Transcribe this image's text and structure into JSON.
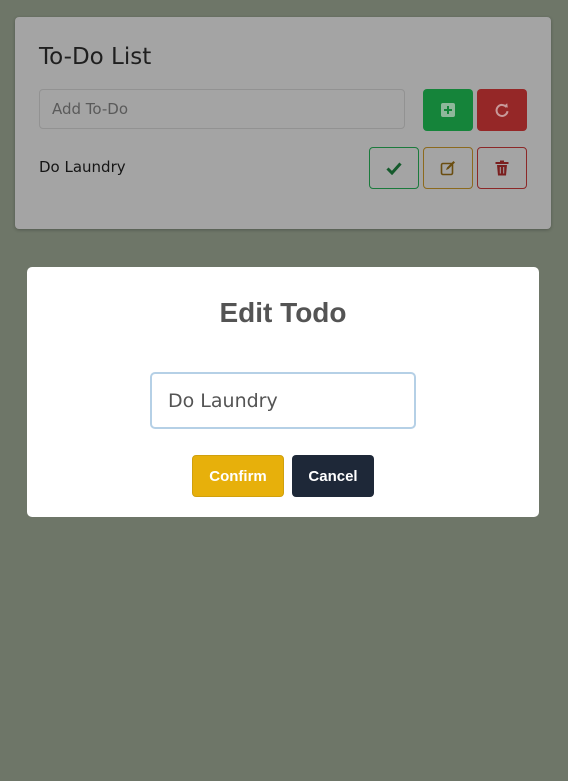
{
  "app": {
    "title": "To-Do List",
    "add_input_placeholder": "Add To-Do",
    "buttons": {
      "add_icon": "plus-square-icon",
      "reset_icon": "redo-icon",
      "complete_icon": "check-icon",
      "edit_icon": "edit-icon",
      "delete_icon": "trash-icon"
    },
    "todos": [
      {
        "text": "Do Laundry"
      }
    ]
  },
  "modal": {
    "title": "Edit Todo",
    "input_value": "Do Laundry",
    "confirm_label": "Confirm",
    "cancel_label": "Cancel"
  },
  "colors": {
    "add": "#15843a",
    "reset": "#952727",
    "confirm": "#e7b00b",
    "cancel": "#1e2838"
  }
}
